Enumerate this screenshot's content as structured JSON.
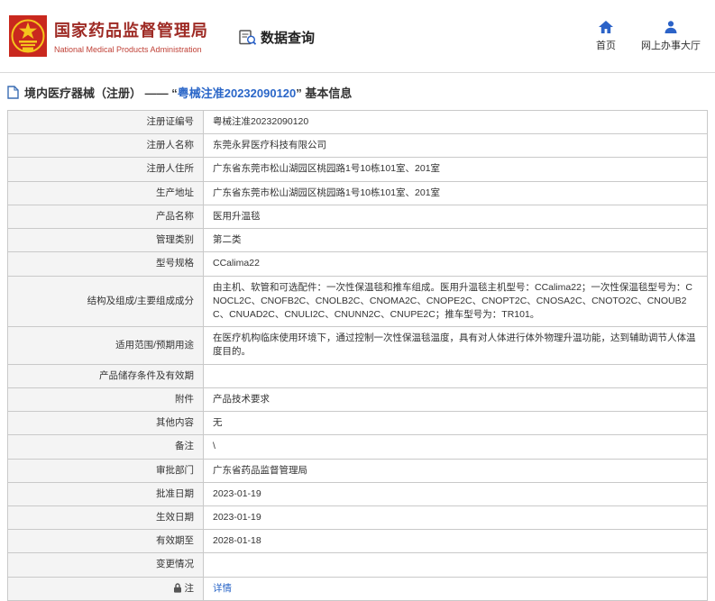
{
  "header": {
    "agency_name_cn": "国家药品监督管理局",
    "agency_name_en": "National Medical Products Administration",
    "page_title": "数据查询",
    "nav": {
      "home": "首页",
      "service_hall": "网上办事大厅"
    }
  },
  "section": {
    "title_prefix": "境内医疗器械（注册） ——  “",
    "title_number": "粤械注准20232090120",
    "title_suffix": "”  基本信息"
  },
  "table": {
    "rows": [
      {
        "label": "注册证编号",
        "value": "粤械注准20232090120"
      },
      {
        "label": "注册人名称",
        "value": "东莞永昇医疗科技有限公司"
      },
      {
        "label": "注册人住所",
        "value": "广东省东莞市松山湖园区桃园路1号10栋101室、201室"
      },
      {
        "label": "生产地址",
        "value": "广东省东莞市松山湖园区桃园路1号10栋101室、201室"
      },
      {
        "label": "产品名称",
        "value": "医用升温毯"
      },
      {
        "label": "管理类别",
        "value": "第二类"
      },
      {
        "label": "型号规格",
        "value": "CCalima22"
      },
      {
        "label": "结构及组成/主要组成成分",
        "value": "由主机、软管和可选配件：一次性保温毯和推车组成。医用升温毯主机型号：CCalima22；一次性保温毯型号为：CNOCL2C、CNOFB2C、CNOLB2C、CNOMA2C、CNOPE2C、CNOPT2C、CNOSA2C、CNOTO2C、CNOUB2C、CNUAD2C、CNULI2C、CNUNN2C、CNUPE2C；推车型号为：TR101。"
      },
      {
        "label": "适用范围/预期用途",
        "value": "在医疗机构临床使用环境下，通过控制一次性保温毯温度，具有对人体进行体外物理升温功能，达到辅助调节人体温度目的。"
      },
      {
        "label": "产品储存条件及有效期",
        "value": ""
      },
      {
        "label": "附件",
        "value": "产品技术要求"
      },
      {
        "label": "其他内容",
        "value": "无"
      },
      {
        "label": "备注",
        "value": "\\"
      },
      {
        "label": "审批部门",
        "value": "广东省药品监督管理局"
      },
      {
        "label": "批准日期",
        "value": "2023-01-19"
      },
      {
        "label": "生效日期",
        "value": "2023-01-19"
      },
      {
        "label": "有效期至",
        "value": "2028-01-18"
      },
      {
        "label": "变更情况",
        "value": ""
      },
      {
        "label": "注",
        "value": "详情"
      }
    ]
  },
  "colors": {
    "brand_red": "#9e2b25",
    "link_blue": "#2a66c8",
    "icon_blue": "#2c63c8",
    "emblem_red": "#c9281e",
    "emblem_gold": "#f5c51d"
  }
}
